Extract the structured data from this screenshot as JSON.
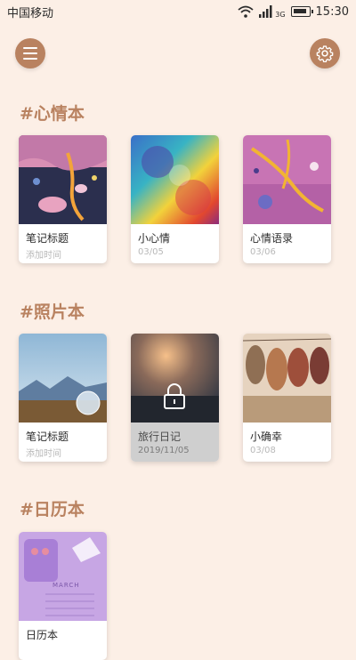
{
  "status": {
    "carrier": "中国移动",
    "network": "3G",
    "time": "15:30",
    "icons": [
      "wifi-icon",
      "signal-icon",
      "battery-icon"
    ]
  },
  "header": {
    "menu_icon": "menu-icon",
    "settings_icon": "gear-icon"
  },
  "sections": {
    "mood": {
      "title": "#心情本",
      "cards": [
        {
          "name": "笔记标题",
          "sub": "添加时间"
        },
        {
          "name": "小心情",
          "sub": "03/05"
        },
        {
          "name": "心情语录",
          "sub": "03/06"
        }
      ]
    },
    "photo": {
      "title": "#照片本",
      "cards": [
        {
          "name": "笔记标题",
          "sub": "添加时间"
        },
        {
          "name": "旅行日记",
          "sub": "2019/11/05",
          "locked": true
        },
        {
          "name": "小确幸",
          "sub": "03/08"
        }
      ]
    },
    "calendar": {
      "title": "#日历本",
      "cards": [
        {
          "name": "日历本",
          "month_label": "MARCH"
        }
      ]
    }
  },
  "colors": {
    "background": "#fcefe6",
    "accent": "#b98260"
  }
}
